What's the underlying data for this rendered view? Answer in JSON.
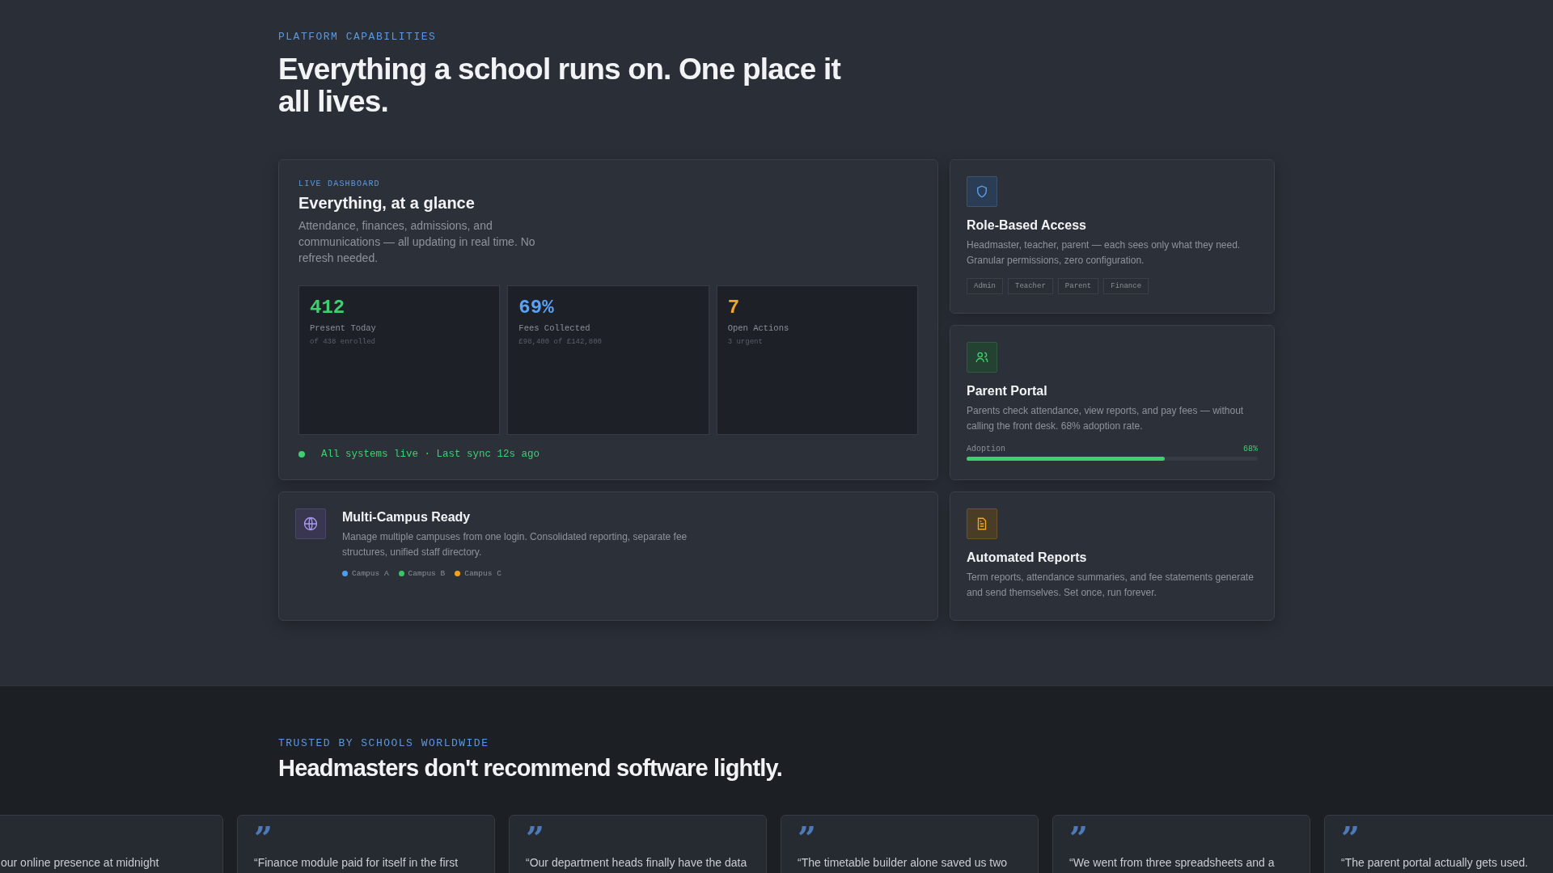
{
  "capabilities": {
    "eyebrow": "PLATFORM CAPABILITIES",
    "headline": "Everything a school runs on. One place it all lives.",
    "dashboard": {
      "eyebrow": "LIVE DASHBOARD",
      "title": "Everything, at a glance",
      "description": "Attendance, finances, admissions, and communications — all updating in real time. No refresh needed.",
      "stats": [
        {
          "value": "412",
          "label": "Present Today",
          "note": "of 438 enrolled",
          "color": "#3ecf6e"
        },
        {
          "value": "69%",
          "label": "Fees Collected",
          "note": "£98,400 of £142,800",
          "color": "#5aa2f5"
        },
        {
          "value": "7",
          "label": "Open Actions",
          "note": "3 urgent",
          "color": "#f5a623"
        }
      ],
      "status": "All systems live · Last sync 12s ago"
    },
    "features": [
      {
        "kind": "tags",
        "title": "Role-Based Access",
        "description": "Headmaster, teacher, parent — each sees only what they need. Granular permissions, zero configuration.",
        "tags": [
          "Admin",
          "Teacher",
          "Parent",
          "Finance"
        ]
      },
      {
        "kind": "progress",
        "title": "Parent Portal",
        "description": "Parents check attendance, view reports, and pay fees — without calling the front desk. 68% adoption rate.",
        "progress": {
          "label": "Adoption",
          "reading": "68%",
          "level": 0.68
        }
      },
      {
        "kind": "campuses",
        "title": "Multi-Campus Ready",
        "description": "Manage multiple campuses from one login. Consolidated reporting, separate fee structures, unified staff directory.",
        "campuses": [
          {
            "name": "Campus A",
            "color": "#4a9ff5"
          },
          {
            "name": "Campus B",
            "color": "#2ecc5e"
          },
          {
            "name": "Campus C",
            "color": "#f5a01a"
          }
        ]
      },
      {
        "kind": "plain",
        "title": "Automated Reports",
        "description": "Term reports, attendance summaries, and fee statements generate and send themselves. Set once, run forever."
      }
    ]
  },
  "testimonials": {
    "eyebrow": "TRUSTED BY SCHOOLS WORLDWIDE",
    "headline": "Headmasters don't recommend software lightly.",
    "cards": [
      {
        "quote": "our online presence at midnight"
      },
      {
        "quote_mark": "”",
        "quote": "“Finance module paid for itself in the first"
      },
      {
        "quote_mark": "”",
        "quote": "“Our department heads finally have the data"
      },
      {
        "quote_mark": "”",
        "quote": "“The timetable builder alone saved us two"
      },
      {
        "quote_mark": "”",
        "quote": "“We went from three spreadsheets and a"
      },
      {
        "quote_mark": "”",
        "quote": "“The parent portal actually gets used."
      }
    ]
  }
}
